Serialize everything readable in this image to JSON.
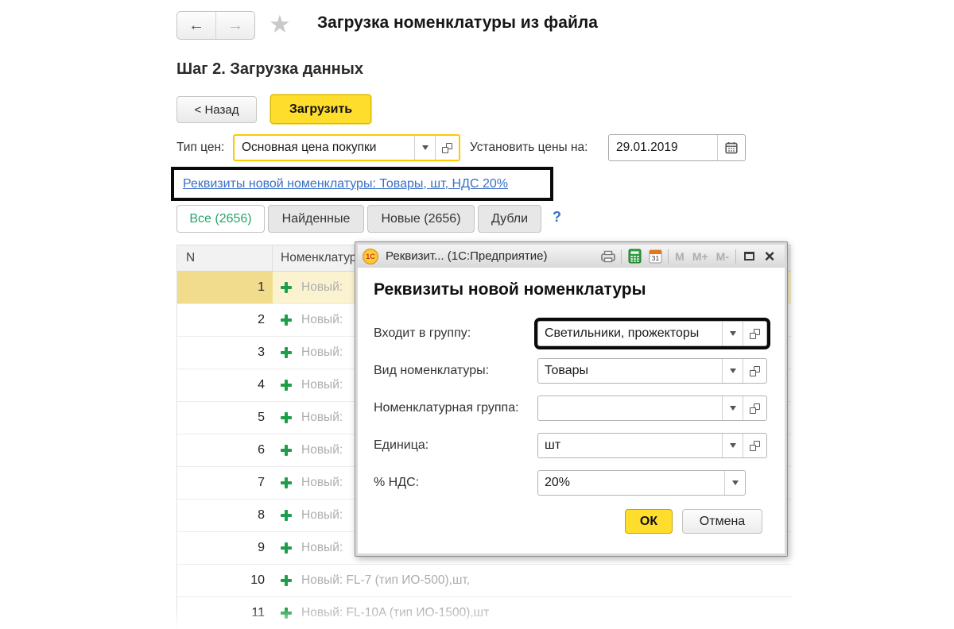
{
  "header": {
    "title": "Загрузка номенклатуры из файла"
  },
  "step_title": "Шаг 2. Загрузка данных",
  "toolbar": {
    "back_label": "< Назад",
    "load_label": "Загрузить"
  },
  "price_row": {
    "price_type_label": "Тип цен:",
    "price_type_value": "Основная цена покупки",
    "set_prices_label": "Установить цены на:",
    "date_value": "29.01.2019"
  },
  "link": {
    "text": "Реквизиты новой номенклатуры: Товары, шт, НДС 20%"
  },
  "tabs": [
    {
      "label": "Все (2656)",
      "active": true
    },
    {
      "label": "Найденные",
      "active": false
    },
    {
      "label": "Новые (2656)",
      "active": false
    },
    {
      "label": "Дубли",
      "active": false
    }
  ],
  "help_label": "?",
  "table": {
    "columns": {
      "n": "N",
      "nomenclature": "Номенклатура"
    },
    "rows": [
      {
        "n": "1",
        "text": "Новый:",
        "selected": true
      },
      {
        "n": "2",
        "text": "Новый:"
      },
      {
        "n": "3",
        "text": "Новый:"
      },
      {
        "n": "4",
        "text": "Новый:"
      },
      {
        "n": "5",
        "text": "Новый:"
      },
      {
        "n": "6",
        "text": "Новый:"
      },
      {
        "n": "7",
        "text": "Новый:"
      },
      {
        "n": "8",
        "text": "Новый:"
      },
      {
        "n": "9",
        "text": "Новый:"
      },
      {
        "n": "10",
        "text": "Новый: FL-7 (тип ИО-500),шт,"
      },
      {
        "n": "11",
        "text": "Новый: FL-10A (тип ИО-1500),шт"
      }
    ]
  },
  "dialog": {
    "logo_text": "1С",
    "title": "Реквизит... (1С:Предприятие)",
    "memory_buttons": {
      "m": "M",
      "m_plus": "M+",
      "m_minus": "M-"
    },
    "calendar_day": "31",
    "heading": "Реквизиты новой номенклатуры",
    "fields": [
      {
        "label": "Входит в группу:",
        "value": "Светильники, прожекторы",
        "highlighted": true
      },
      {
        "label": "Вид номенклатуры:",
        "value": "Товары"
      },
      {
        "label": "Номенклатурная группа:",
        "value": ""
      },
      {
        "label": "Единица:",
        "value": "шт"
      },
      {
        "label": "% НДС:",
        "value": "20%"
      }
    ],
    "ok_label": "ОК",
    "cancel_label": "Отмена"
  },
  "icons": {
    "back_arrow": "←",
    "forward_arrow": "→",
    "star": "★",
    "close": "×"
  },
  "colors": {
    "accent_yellow": "#ffdd2d",
    "focus_yellow_border": "#ffc800",
    "link_blue": "#3a6fc4",
    "tab_active_green": "#2aa36a",
    "plus_green": "#1e9e4a",
    "highlight_black": "#0a0a0a",
    "selected_row_n": "#f1dc8d",
    "selected_row_cell": "#fbf3d0"
  }
}
